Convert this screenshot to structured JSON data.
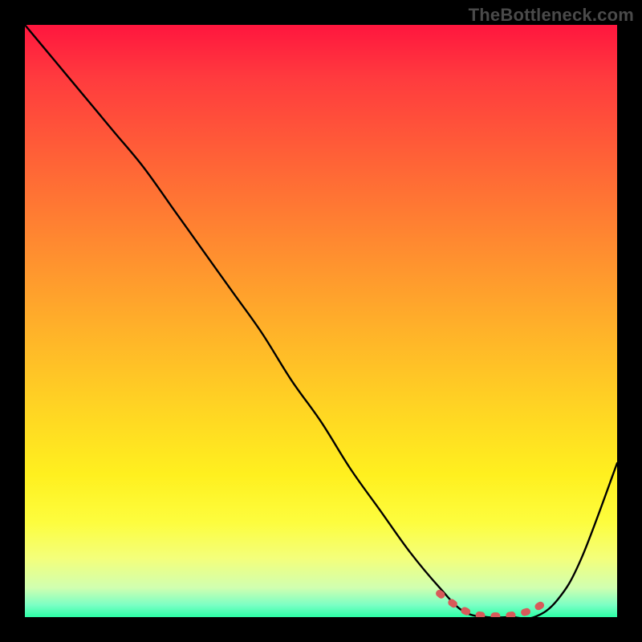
{
  "watermark": "TheBottleneck.com",
  "chart_data": {
    "type": "line",
    "title": "",
    "xlabel": "",
    "ylabel": "",
    "xlim": [
      0,
      100
    ],
    "ylim": [
      0,
      100
    ],
    "series": [
      {
        "name": "curve",
        "color": "#000000",
        "x": [
          0,
          5,
          10,
          15,
          20,
          25,
          30,
          35,
          40,
          45,
          50,
          55,
          60,
          65,
          70,
          74,
          78,
          82,
          86,
          90,
          94,
          100
        ],
        "y": [
          100,
          94,
          88,
          82,
          76,
          69,
          62,
          55,
          48,
          40,
          33,
          25,
          18,
          11,
          5,
          1,
          0,
          0,
          0,
          3,
          10,
          26
        ]
      },
      {
        "name": "highlight",
        "color": "#e06666",
        "x": [
          70,
          72,
          74,
          76,
          78,
          80,
          82,
          84,
          86,
          88
        ],
        "y": [
          4,
          2.5,
          1.2,
          0.5,
          0.2,
          0.2,
          0.3,
          0.7,
          1.4,
          2.6
        ]
      }
    ]
  }
}
